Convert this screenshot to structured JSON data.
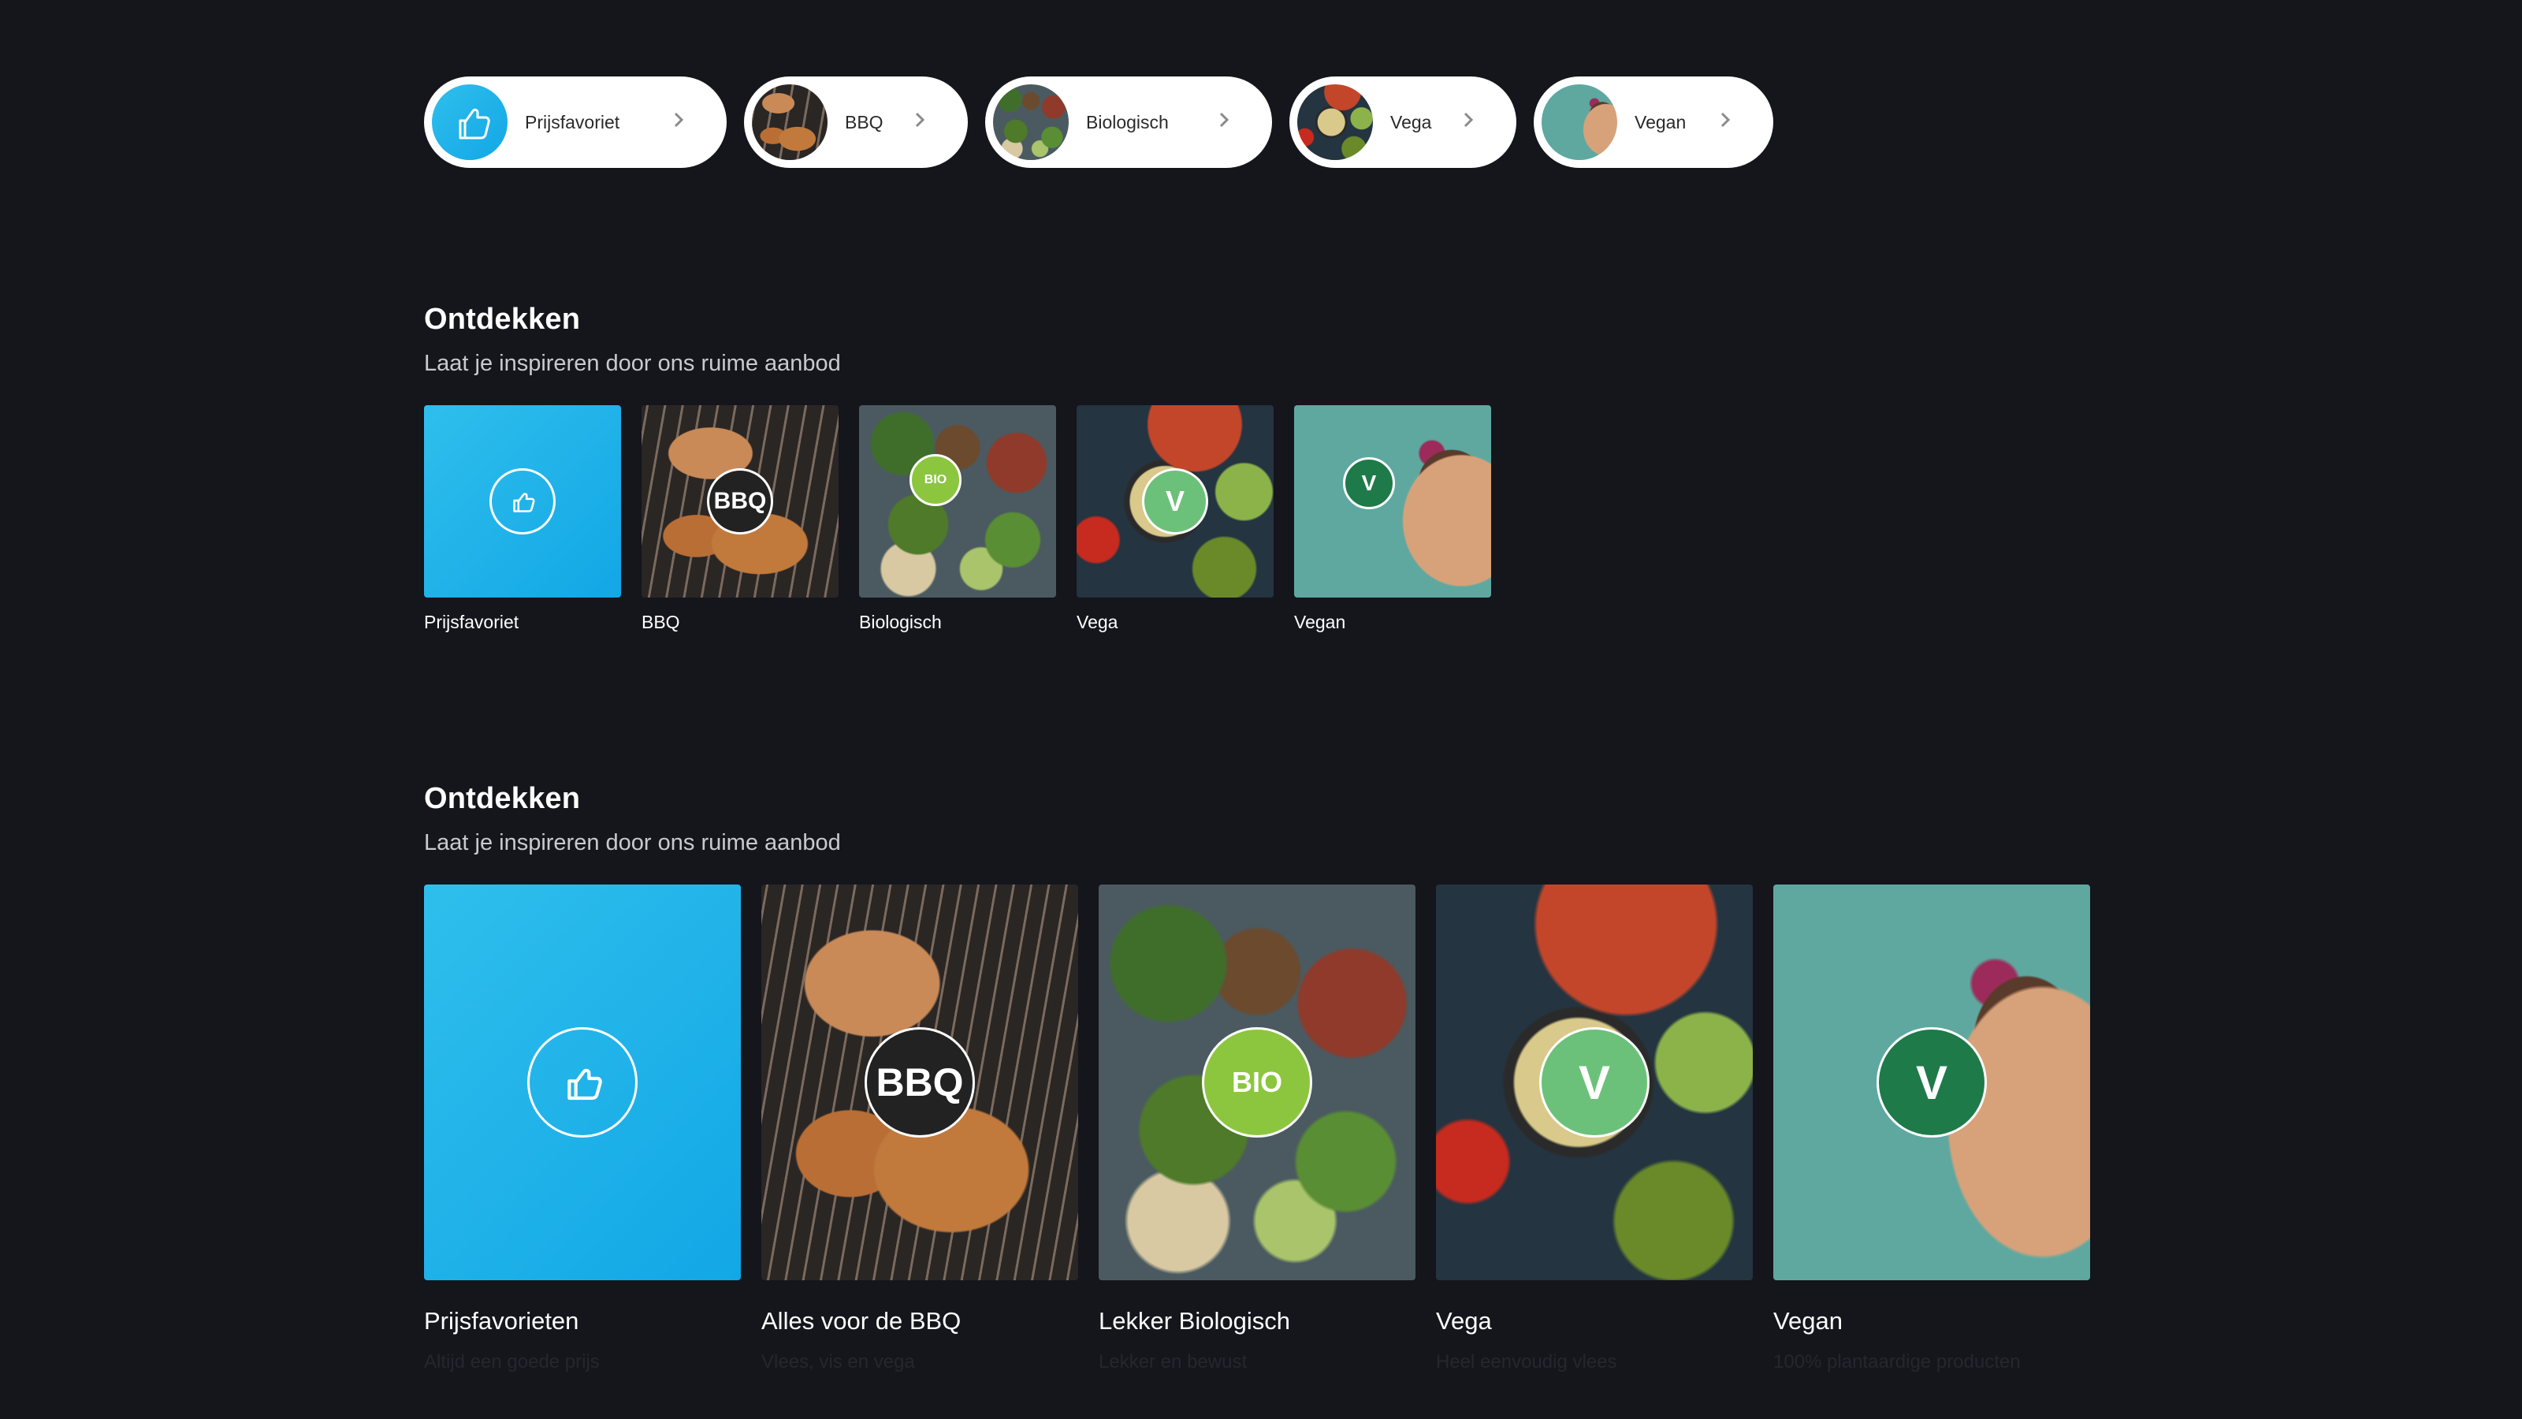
{
  "pills": [
    {
      "label": "Prijsfavoriet",
      "icon": "thumbs-up-icon"
    },
    {
      "label": "BBQ",
      "icon": "bbq-photo"
    },
    {
      "label": "Biologisch",
      "icon": "bio-photo"
    },
    {
      "label": "Vega",
      "icon": "vega-photo"
    },
    {
      "label": "Vegan",
      "icon": "vegan-photo"
    }
  ],
  "section1": {
    "title": "Ontdekken",
    "subtitle": "Laat je inspireren door ons ruime aanbod",
    "cards": [
      {
        "caption": "Prijsfavoriet"
      },
      {
        "caption": "BBQ",
        "badge": "BBQ"
      },
      {
        "caption": "Biologisch",
        "badge": "BIO"
      },
      {
        "caption": "Vega",
        "badge": "V"
      },
      {
        "caption": "Vegan",
        "badge": "V"
      }
    ]
  },
  "section2": {
    "title": "Ontdekken",
    "subtitle": "Laat je inspireren door ons ruime aanbod",
    "cards": [
      {
        "caption": "Prijsfavorieten",
        "sub": "Altijd een goede prijs"
      },
      {
        "caption": "Alles voor de BBQ",
        "sub": "Vlees, vis en vega",
        "badge": "BBQ"
      },
      {
        "caption": "Lekker Biologisch",
        "sub": "Lekker en bewust",
        "badge": "BIO"
      },
      {
        "caption": "Vega",
        "sub": "Heel eenvoudig vlees",
        "badge": "V"
      },
      {
        "caption": "Vegan",
        "sub": "100% plantaardige producten",
        "badge": "V"
      }
    ]
  },
  "colors": {
    "background": "#15151c",
    "prijs_blue": "#12a7e6",
    "bio_green": "#8cc63f",
    "vega_green": "#6cc17a",
    "vegan_green": "#1f7a4a"
  }
}
